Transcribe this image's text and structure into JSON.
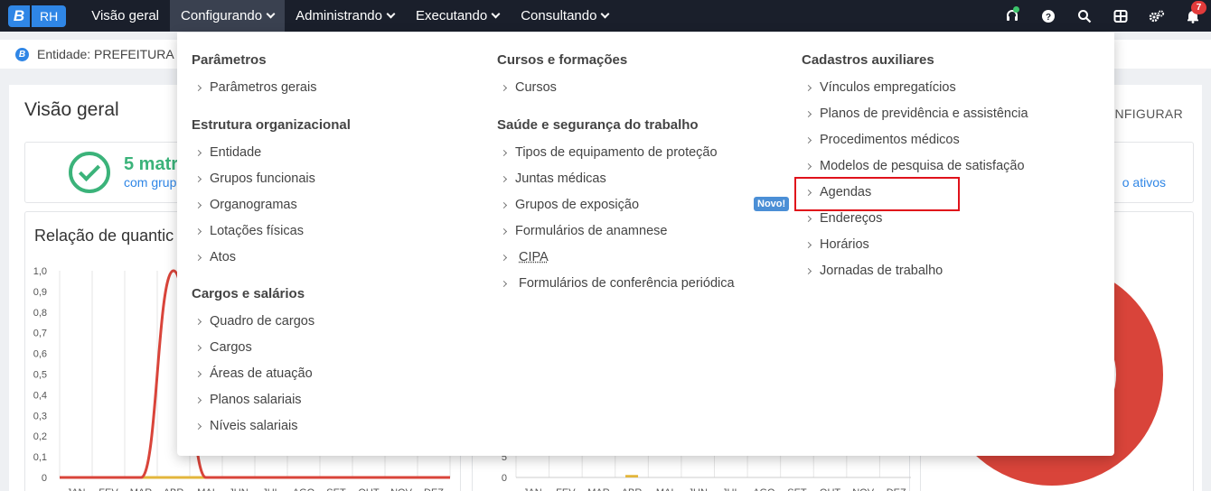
{
  "brand": {
    "logo_letter": "B",
    "product": "RH"
  },
  "nav": {
    "items": [
      {
        "label": "Visão geral",
        "has_caret": false,
        "active": false
      },
      {
        "label": "Configurando",
        "has_caret": true,
        "active": true
      },
      {
        "label": "Administrando",
        "has_caret": true,
        "active": false
      },
      {
        "label": "Executando",
        "has_caret": true,
        "active": false
      },
      {
        "label": "Consultando",
        "has_caret": true,
        "active": false
      }
    ],
    "notification_count": "7"
  },
  "entity": {
    "icon_letter": "B",
    "label": "Entidade: PREFEITURA D"
  },
  "page": {
    "title": "Visão geral",
    "configurar": "CONFIGURAR"
  },
  "summary": {
    "value": "5 matr",
    "sub": "com grup",
    "right_link": "o ativos"
  },
  "charts": {
    "title_left": "Relação de quantic"
  },
  "chart_data": [
    {
      "type": "line",
      "categories": [
        "JAN",
        "FEV",
        "MAR",
        "ABR",
        "MAI",
        "JUN",
        "JUL",
        "AGO",
        "SET",
        "OUT",
        "NOV",
        "DEZ"
      ],
      "series": [
        {
          "values": [
            0,
            0,
            0,
            1.0,
            0,
            0,
            0,
            0,
            0,
            0,
            0,
            0
          ],
          "color": "#d9443a"
        },
        {
          "values": [
            0,
            0,
            0,
            0,
            0,
            0,
            0,
            0,
            0,
            0,
            0,
            0
          ],
          "color": "#e3b63c"
        }
      ],
      "yticks": [
        "0",
        "0,1",
        "0,2",
        "0,3",
        "0,4",
        "0,5",
        "0,6",
        "0,7",
        "0,8",
        "0,9",
        "1,0"
      ],
      "ylim": [
        0,
        1.0
      ]
    },
    {
      "type": "bar",
      "categories": [
        "JAN",
        "FEV",
        "MAR",
        "ABR",
        "MAI",
        "JUN",
        "JUL",
        "AGO",
        "SET",
        "OUT",
        "NOV",
        "DEZ"
      ],
      "values": [
        0,
        0,
        0,
        0.3,
        0,
        0,
        0,
        0,
        0,
        0,
        0,
        0
      ],
      "color": "#e3b63c",
      "yticks": [
        "0",
        "5"
      ]
    },
    {
      "type": "pie",
      "color": "#d9443a"
    }
  ],
  "mega_menu": {
    "columns": [
      {
        "groups": [
          {
            "title": "Parâmetros",
            "items": [
              "Parâmetros gerais"
            ]
          },
          {
            "title": "Estrutura organizacional",
            "items": [
              "Entidade",
              "Grupos funcionais",
              "Organogramas",
              "Lotações físicas",
              "Atos"
            ]
          },
          {
            "title": "Cargos e salários",
            "items": [
              "Quadro de cargos",
              "Cargos",
              "Áreas de atuação",
              "Planos salariais",
              "Níveis salariais"
            ]
          }
        ]
      },
      {
        "groups": [
          {
            "title": "Cursos e formações",
            "items": [
              "Cursos"
            ]
          },
          {
            "title": "Saúde e segurança do trabalho",
            "items": [
              "Tipos de equipamento de proteção",
              "Juntas médicas",
              "Grupos de exposição",
              "Formulários de anamnese",
              "CIPA",
              "Formulários de conferência periódica"
            ]
          }
        ]
      },
      {
        "groups": [
          {
            "title": "Cadastros auxiliares",
            "items": [
              "Vínculos empregatícios",
              "Planos de previdência e assistência",
              "Procedimentos médicos",
              "Modelos de pesquisa de satisfação",
              "Agendas",
              "Endereços",
              "Horários",
              "Jornadas de trabalho"
            ]
          }
        ]
      }
    ],
    "novo_badge": "Novo!"
  }
}
